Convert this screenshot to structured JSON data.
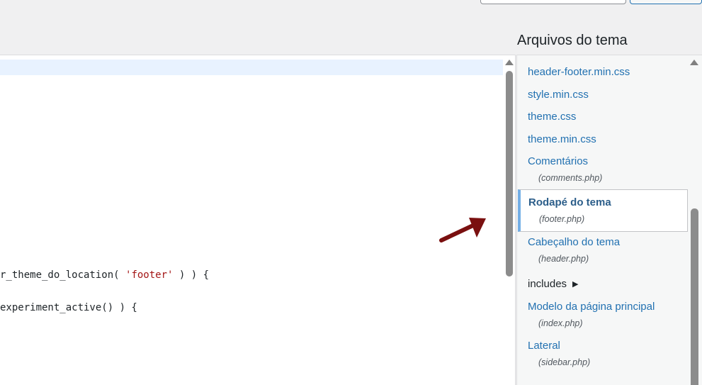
{
  "sidebar": {
    "title": "Arquivos do tema",
    "files": [
      {
        "label": "header-footer.min.css"
      },
      {
        "label": "style.min.css"
      },
      {
        "label": "theme.css"
      },
      {
        "label": "theme.min.css"
      },
      {
        "label": "Comentários",
        "file": "(comments.php)"
      },
      {
        "label": "Rodapé do tema",
        "file": "(footer.php)",
        "active": true
      },
      {
        "label": "Cabeçalho do tema",
        "file": "(header.php)"
      },
      {
        "label": "includes",
        "folder": true
      },
      {
        "label": "Modelo da página principal",
        "file": "(index.php)"
      },
      {
        "label": "Lateral",
        "file": "(sidebar.php)"
      }
    ]
  },
  "editor": {
    "lines": [
      {
        "before": "r_theme_do_location( ",
        "string": "'footer'",
        "after": " ) ) {"
      },
      {
        "before": "experiment_active() ) {",
        "string": "",
        "after": ""
      }
    ]
  },
  "annotation": {
    "arrow_color": "#7a1010"
  },
  "colors": {
    "link": "#2271b1",
    "active_marker": "#72aee6",
    "string": "#a31515"
  }
}
